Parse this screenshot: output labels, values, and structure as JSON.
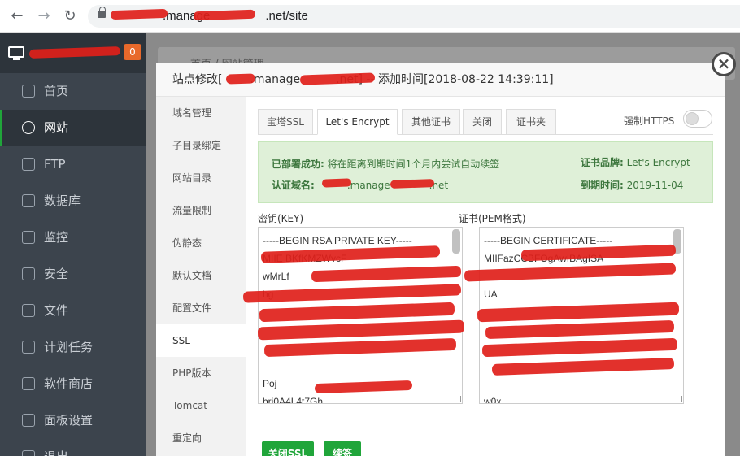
{
  "browser": {
    "back_icon": "←",
    "forward_icon": "→",
    "reload_icon": "↻",
    "url_host": ".manage",
    "url_tail": ".net/site"
  },
  "sidebar": {
    "badge": "0",
    "items": [
      {
        "label": "首页",
        "icon": "home-icon"
      },
      {
        "label": "网站",
        "icon": "globe-icon"
      },
      {
        "label": "FTP",
        "icon": "ftp-icon"
      },
      {
        "label": "数据库",
        "icon": "database-icon"
      },
      {
        "label": "监控",
        "icon": "monitor-chart-icon"
      },
      {
        "label": "安全",
        "icon": "shield-icon"
      },
      {
        "label": "文件",
        "icon": "folder-icon"
      },
      {
        "label": "计划任务",
        "icon": "calendar-icon"
      },
      {
        "label": "软件商店",
        "icon": "grid-icon"
      },
      {
        "label": "面板设置",
        "icon": "gear-icon"
      },
      {
        "label": "退出",
        "icon": "logout-icon"
      }
    ]
  },
  "background": {
    "breadcrumb": "首页 / 网站管理"
  },
  "modal": {
    "title_prefix": "站点修改[",
    "title_mid": ".manage",
    "title_suffix": ".net] -- 添加时间[2018-08-22 14:39:11]",
    "close_icon": "×",
    "menu": [
      "域名管理",
      "子目录绑定",
      "网站目录",
      "流量限制",
      "伪静态",
      "默认文档",
      "配置文件",
      "SSL",
      "PHP版本",
      "Tomcat",
      "重定向"
    ],
    "tabs": [
      "宝塔SSL",
      "Let's Encrypt",
      "其他证书",
      "关闭",
      "证书夹"
    ],
    "force_https_label": "强制HTTPS",
    "info": {
      "deployed_label": "已部署成功:",
      "deployed_text": "将在距离到期时间1个月内尝试自动续签",
      "domain_label": "认证域名:",
      "domain_mid": ".manage",
      "domain_suffix": ".net",
      "brand_label": "证书品牌:",
      "brand_value": "Let's Encrypt",
      "expiry_label": "到期时间:",
      "expiry_value": "2019-11-04"
    },
    "key_label": "密钥(KEY)",
    "cert_label": "证书(PEM格式)",
    "key_lines": [
      "-----BEGIN RSA PRIVATE KEY-----",
      "MIIE              BKfKMZWvcF",
      "wMrLf",
      "hg",
      "",
      "",
      "",
      "",
      "Poj",
      "brj0A4L4t7Gh"
    ],
    "cert_lines": [
      "-----BEGIN CERTIFICATE-----",
      "MIIFazCCBFOgAwIBAgISA",
      "",
      "UA",
      "",
      "",
      "",
      "",
      "",
      "w0x"
    ],
    "close_ssl_button": "关闭SSL",
    "renew_button": "续签"
  }
}
